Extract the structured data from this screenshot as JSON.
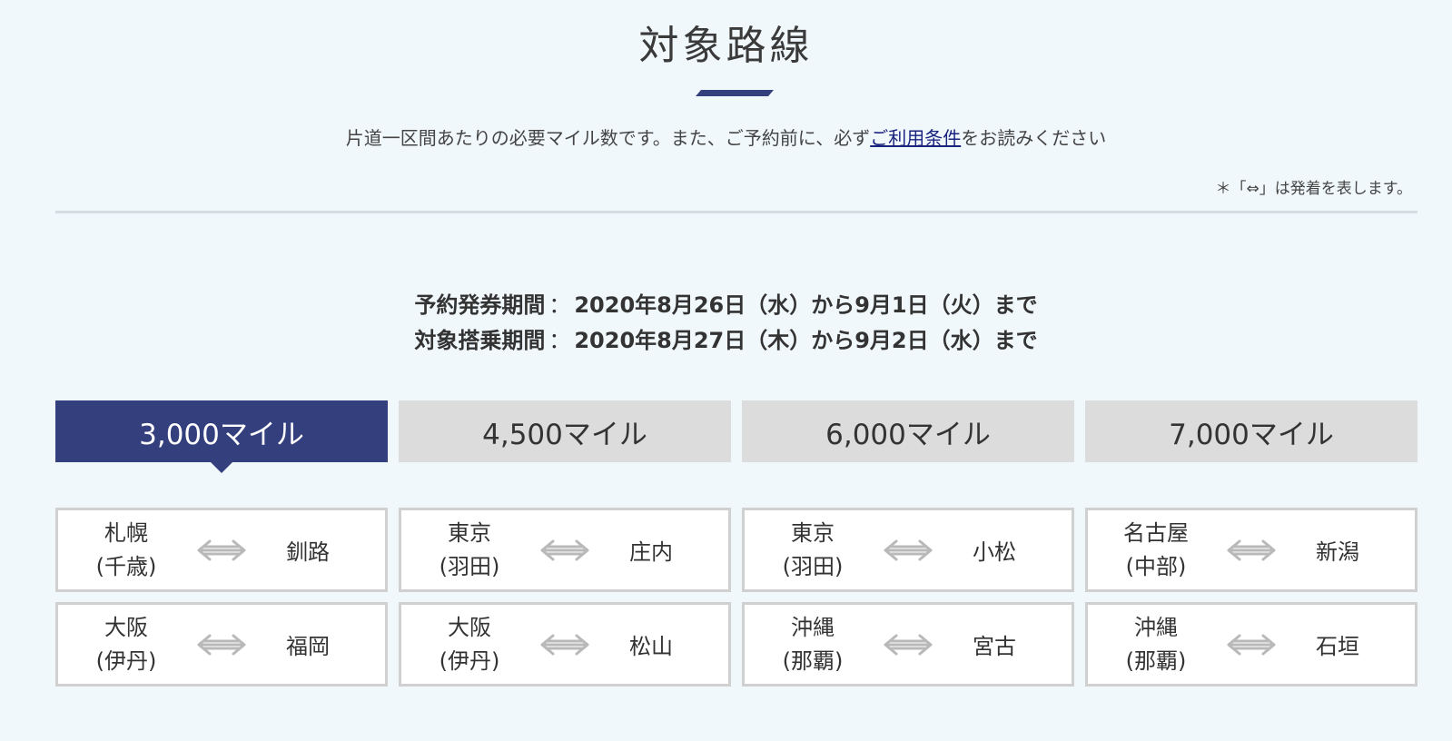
{
  "header": {
    "title": "対象路線",
    "lead_before": "片道一区間あたりの必要マイル数です。また、ご予約前に、必ず",
    "lead_link": "ご利用条件",
    "lead_after": "をお読みください",
    "note": "＊「⇔」は発着を表します。"
  },
  "periods": [
    {
      "label": "予約発券期間",
      "colon": "：",
      "value": "2020年8月26日（水）から9月1日（火）まで"
    },
    {
      "label": "対象搭乗期間",
      "colon": "：",
      "value": "2020年8月27日（木）から9月2日（水）まで"
    }
  ],
  "tabs": [
    {
      "label": "3,000マイル",
      "active": true
    },
    {
      "label": "4,500マイル",
      "active": false
    },
    {
      "label": "6,000マイル",
      "active": false
    },
    {
      "label": "7,000マイル",
      "active": false
    }
  ],
  "routes": [
    {
      "from": "札幌",
      "from_sub": "(千歳)",
      "to": "釧路"
    },
    {
      "from": "東京",
      "from_sub": "(羽田)",
      "to": "庄内"
    },
    {
      "from": "東京",
      "from_sub": "(羽田)",
      "to": "小松"
    },
    {
      "from": "名古屋",
      "from_sub": "(中部)",
      "to": "新潟"
    },
    {
      "from": "大阪",
      "from_sub": "(伊丹)",
      "to": "福岡"
    },
    {
      "from": "大阪",
      "from_sub": "(伊丹)",
      "to": "松山"
    },
    {
      "from": "沖縄",
      "from_sub": "(那覇)",
      "to": "宮古"
    },
    {
      "from": "沖縄",
      "from_sub": "(那覇)",
      "to": "石垣"
    }
  ],
  "colors": {
    "accent": "#343f7d",
    "tab_inactive": "#dcdcdc",
    "background": "#f0f8fc"
  },
  "icons": {
    "route_arrow": "double-arrow-icon"
  }
}
